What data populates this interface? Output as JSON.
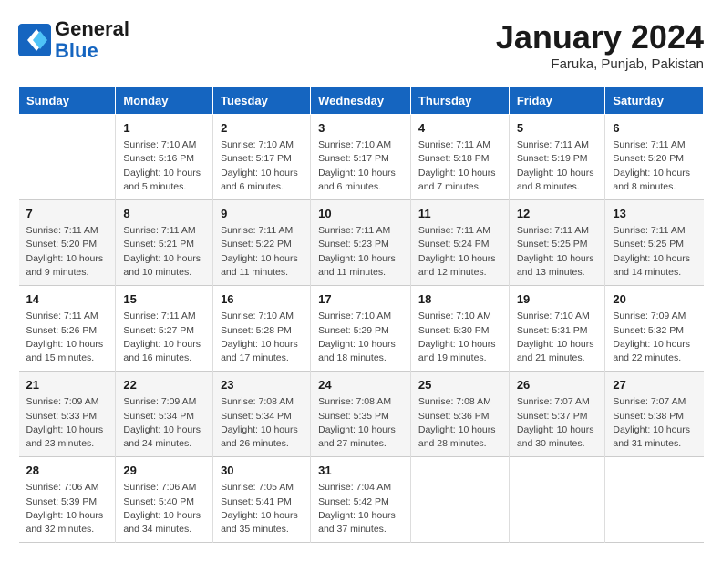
{
  "header": {
    "logo_line1": "General",
    "logo_line2": "Blue",
    "month": "January 2024",
    "location": "Faruka, Punjab, Pakistan"
  },
  "days_of_week": [
    "Sunday",
    "Monday",
    "Tuesday",
    "Wednesday",
    "Thursday",
    "Friday",
    "Saturday"
  ],
  "weeks": [
    [
      {
        "day": "",
        "info": ""
      },
      {
        "day": "1",
        "info": "Sunrise: 7:10 AM\nSunset: 5:16 PM\nDaylight: 10 hours\nand 5 minutes."
      },
      {
        "day": "2",
        "info": "Sunrise: 7:10 AM\nSunset: 5:17 PM\nDaylight: 10 hours\nand 6 minutes."
      },
      {
        "day": "3",
        "info": "Sunrise: 7:10 AM\nSunset: 5:17 PM\nDaylight: 10 hours\nand 6 minutes."
      },
      {
        "day": "4",
        "info": "Sunrise: 7:11 AM\nSunset: 5:18 PM\nDaylight: 10 hours\nand 7 minutes."
      },
      {
        "day": "5",
        "info": "Sunrise: 7:11 AM\nSunset: 5:19 PM\nDaylight: 10 hours\nand 8 minutes."
      },
      {
        "day": "6",
        "info": "Sunrise: 7:11 AM\nSunset: 5:20 PM\nDaylight: 10 hours\nand 8 minutes."
      }
    ],
    [
      {
        "day": "7",
        "info": "Sunrise: 7:11 AM\nSunset: 5:20 PM\nDaylight: 10 hours\nand 9 minutes."
      },
      {
        "day": "8",
        "info": "Sunrise: 7:11 AM\nSunset: 5:21 PM\nDaylight: 10 hours\nand 10 minutes."
      },
      {
        "day": "9",
        "info": "Sunrise: 7:11 AM\nSunset: 5:22 PM\nDaylight: 10 hours\nand 11 minutes."
      },
      {
        "day": "10",
        "info": "Sunrise: 7:11 AM\nSunset: 5:23 PM\nDaylight: 10 hours\nand 11 minutes."
      },
      {
        "day": "11",
        "info": "Sunrise: 7:11 AM\nSunset: 5:24 PM\nDaylight: 10 hours\nand 12 minutes."
      },
      {
        "day": "12",
        "info": "Sunrise: 7:11 AM\nSunset: 5:25 PM\nDaylight: 10 hours\nand 13 minutes."
      },
      {
        "day": "13",
        "info": "Sunrise: 7:11 AM\nSunset: 5:25 PM\nDaylight: 10 hours\nand 14 minutes."
      }
    ],
    [
      {
        "day": "14",
        "info": "Sunrise: 7:11 AM\nSunset: 5:26 PM\nDaylight: 10 hours\nand 15 minutes."
      },
      {
        "day": "15",
        "info": "Sunrise: 7:11 AM\nSunset: 5:27 PM\nDaylight: 10 hours\nand 16 minutes."
      },
      {
        "day": "16",
        "info": "Sunrise: 7:10 AM\nSunset: 5:28 PM\nDaylight: 10 hours\nand 17 minutes."
      },
      {
        "day": "17",
        "info": "Sunrise: 7:10 AM\nSunset: 5:29 PM\nDaylight: 10 hours\nand 18 minutes."
      },
      {
        "day": "18",
        "info": "Sunrise: 7:10 AM\nSunset: 5:30 PM\nDaylight: 10 hours\nand 19 minutes."
      },
      {
        "day": "19",
        "info": "Sunrise: 7:10 AM\nSunset: 5:31 PM\nDaylight: 10 hours\nand 21 minutes."
      },
      {
        "day": "20",
        "info": "Sunrise: 7:09 AM\nSunset: 5:32 PM\nDaylight: 10 hours\nand 22 minutes."
      }
    ],
    [
      {
        "day": "21",
        "info": "Sunrise: 7:09 AM\nSunset: 5:33 PM\nDaylight: 10 hours\nand 23 minutes."
      },
      {
        "day": "22",
        "info": "Sunrise: 7:09 AM\nSunset: 5:34 PM\nDaylight: 10 hours\nand 24 minutes."
      },
      {
        "day": "23",
        "info": "Sunrise: 7:08 AM\nSunset: 5:34 PM\nDaylight: 10 hours\nand 26 minutes."
      },
      {
        "day": "24",
        "info": "Sunrise: 7:08 AM\nSunset: 5:35 PM\nDaylight: 10 hours\nand 27 minutes."
      },
      {
        "day": "25",
        "info": "Sunrise: 7:08 AM\nSunset: 5:36 PM\nDaylight: 10 hours\nand 28 minutes."
      },
      {
        "day": "26",
        "info": "Sunrise: 7:07 AM\nSunset: 5:37 PM\nDaylight: 10 hours\nand 30 minutes."
      },
      {
        "day": "27",
        "info": "Sunrise: 7:07 AM\nSunset: 5:38 PM\nDaylight: 10 hours\nand 31 minutes."
      }
    ],
    [
      {
        "day": "28",
        "info": "Sunrise: 7:06 AM\nSunset: 5:39 PM\nDaylight: 10 hours\nand 32 minutes."
      },
      {
        "day": "29",
        "info": "Sunrise: 7:06 AM\nSunset: 5:40 PM\nDaylight: 10 hours\nand 34 minutes."
      },
      {
        "day": "30",
        "info": "Sunrise: 7:05 AM\nSunset: 5:41 PM\nDaylight: 10 hours\nand 35 minutes."
      },
      {
        "day": "31",
        "info": "Sunrise: 7:04 AM\nSunset: 5:42 PM\nDaylight: 10 hours\nand 37 minutes."
      },
      {
        "day": "",
        "info": ""
      },
      {
        "day": "",
        "info": ""
      },
      {
        "day": "",
        "info": ""
      }
    ]
  ]
}
